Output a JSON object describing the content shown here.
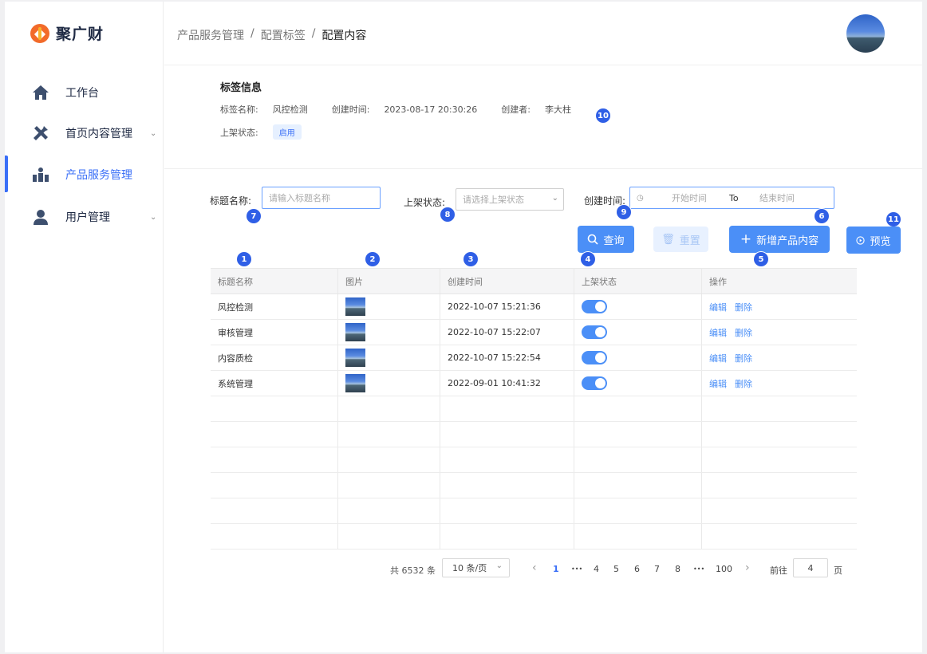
{
  "app": {
    "name": "聚广财"
  },
  "sidebar": {
    "items": [
      {
        "label": "工作台",
        "has_submenu": false,
        "active": false
      },
      {
        "label": "首页内容管理",
        "has_submenu": true,
        "active": false
      },
      {
        "label": "产品服务管理",
        "has_submenu": false,
        "active": true
      },
      {
        "label": "用户管理",
        "has_submenu": true,
        "active": false
      }
    ]
  },
  "breadcrumb": [
    "产品服务管理",
    "配置标签",
    "配置内容"
  ],
  "breadcrumb_sep": "/",
  "tag_info": {
    "title": "标签信息",
    "name_label": "标签名称:",
    "name_value": "风控检测",
    "created_label": "创建时间:",
    "created_value": "2023-08-17  20:30:26",
    "creator_label": "创建者:",
    "creator_value": "李大柱",
    "status_label": "上架状态:",
    "status_value": "启用"
  },
  "filters": {
    "title_label": "标题名称:",
    "title_placeholder": "请输入标题名称",
    "status_label": "上架状态:",
    "status_placeholder": "请选择上架状态",
    "time_label": "创建时间:",
    "start_placeholder": "开始时间",
    "range_sep": "To",
    "end_placeholder": "结束时间"
  },
  "buttons": {
    "query": "查询",
    "reset": "重置",
    "add": "新增产品内容",
    "preview": "预览"
  },
  "markers": [
    "1",
    "2",
    "3",
    "4",
    "5",
    "6",
    "7",
    "8",
    "9",
    "10",
    "11"
  ],
  "table": {
    "columns": [
      "标题名称",
      "图片",
      "创建时间",
      "上架状态",
      "操作"
    ],
    "rows": [
      {
        "title": "风控检测",
        "created": "2022-10-07 15:21:36",
        "enabled": true
      },
      {
        "title": "审核管理",
        "created": "2022-10-07 15:22:07",
        "enabled": true
      },
      {
        "title": "内容质检",
        "created": "2022-10-07 15:22:54",
        "enabled": true
      },
      {
        "title": "系统管理",
        "created": "2022-09-01 10:41:32",
        "enabled": true
      }
    ],
    "edit_label": "编辑",
    "delete_label": "删除"
  },
  "pagination": {
    "total": "共 6532 条",
    "page_size": "10 条/页",
    "prev": "‹",
    "next": "›",
    "pages": [
      "1",
      "•••",
      "4",
      "5",
      "6",
      "7",
      "8",
      "•••",
      "100"
    ],
    "current": "1",
    "goto_label": "前往",
    "goto_value": "4",
    "goto_unit": "页"
  },
  "colors": {
    "accent": "#3a6ff7",
    "button": "#4b8ff7",
    "marker": "#2f5fe6",
    "logo": "#f26b2a"
  }
}
